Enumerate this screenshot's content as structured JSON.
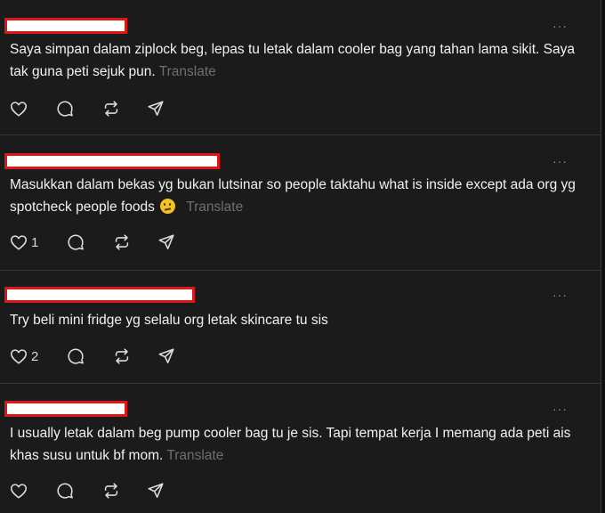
{
  "posts": [
    {
      "text": "Saya simpan dalam ziplock beg, lepas tu letak dalam cooler bag yang tahan lama sikit. Saya tak guna peti sejuk pun.",
      "translate": "Translate",
      "likes": ""
    },
    {
      "text": "Masukkan dalam bekas yg bukan lutsinar so people taktahu what is inside except ada org yg spotcheck people foods",
      "emoji": "thinking-face",
      "translate": "Translate",
      "likes": "1"
    },
    {
      "text": "Try beli mini fridge yg selalu org letak skincare tu sis",
      "translate": "",
      "likes": "2"
    },
    {
      "text": "I usually letak dalam beg pump cooler bag tu je sis. Tapi tempat kerja I memang ada peti ais khas susu untuk bf mom.",
      "translate": "Translate",
      "likes": ""
    }
  ],
  "more_label": "···",
  "colors": {
    "background": "#1b1b1b",
    "text": "#f1f1f1",
    "muted": "#6f6f6f",
    "redaction_border": "#e01515",
    "divider": "#353535"
  },
  "icons": [
    "heart-icon",
    "comment-icon",
    "repost-icon",
    "share-icon",
    "more-icon"
  ]
}
